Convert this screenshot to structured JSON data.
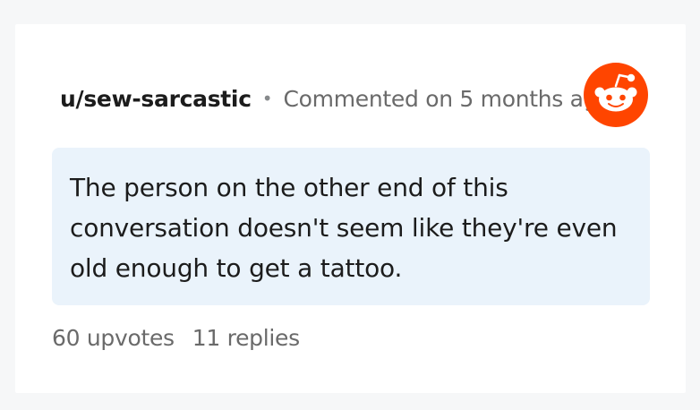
{
  "comment": {
    "username": "u/sew-sarcastic",
    "separator": "•",
    "meta": "Commented on 5 months ago",
    "body": "The person on the other end of this conversation doesn't seem like they're even old enough to get a tattoo.",
    "upvotes": "60 upvotes",
    "replies": "11 replies"
  },
  "logo": {
    "icon": "reddit-snoo-icon",
    "color": "#ff4500"
  },
  "colors": {
    "bubble": "#eaf3fb",
    "page_bg": "#f6f7f8"
  }
}
